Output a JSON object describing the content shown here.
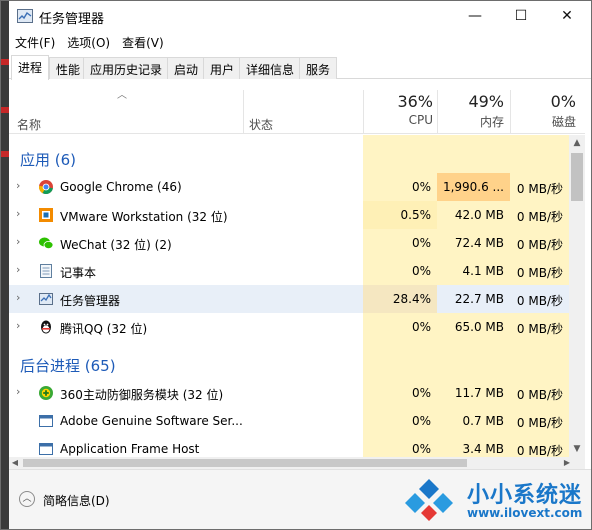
{
  "window": {
    "title": "任务管理器",
    "controls": {
      "minimize": "—",
      "maximize": "☐",
      "close": "✕"
    }
  },
  "menu": [
    "文件(F)",
    "选项(O)",
    "查看(V)"
  ],
  "tabs": [
    "进程",
    "性能",
    "应用历史记录",
    "启动",
    "用户",
    "详细信息",
    "服务"
  ],
  "active_tab": "进程",
  "columns": {
    "name": "名称",
    "status": "状态",
    "cpu": {
      "percent": "36%",
      "label": "CPU"
    },
    "memory": {
      "percent": "49%",
      "label": "内存"
    },
    "disk": {
      "percent": "0%",
      "label": "磁盘"
    }
  },
  "groups": [
    {
      "title": "应用 (6)",
      "rows": [
        {
          "name": "Google Chrome (46)",
          "icon": "chrome-icon",
          "cpu": "0%",
          "memory": "1,990.6 ...",
          "disk": "0 MB/秒"
        },
        {
          "name": "VMware Workstation (32 位)",
          "icon": "vmware-icon",
          "cpu": "0.5%",
          "memory": "42.0 MB",
          "disk": "0 MB/秒"
        },
        {
          "name": "WeChat (32 位) (2)",
          "icon": "wechat-icon",
          "cpu": "0%",
          "memory": "72.4 MB",
          "disk": "0 MB/秒"
        },
        {
          "name": "记事本",
          "icon": "notepad-icon",
          "cpu": "0%",
          "memory": "4.1 MB",
          "disk": "0 MB/秒"
        },
        {
          "name": "任务管理器",
          "icon": "task-manager-icon",
          "cpu": "28.4%",
          "memory": "22.7 MB",
          "disk": "0 MB/秒"
        },
        {
          "name": "腾讯QQ (32 位)",
          "icon": "qq-icon",
          "cpu": "0%",
          "memory": "65.0 MB",
          "disk": "0 MB/秒"
        }
      ]
    },
    {
      "title": "后台进程 (65)",
      "rows": [
        {
          "name": "360主动防御服务模块 (32 位)",
          "icon": "360-icon",
          "cpu": "0%",
          "memory": "11.7 MB",
          "disk": "0 MB/秒"
        },
        {
          "name": "Adobe Genuine Software Ser...",
          "icon": "app-window-icon",
          "cpu": "0%",
          "memory": "0.7 MB",
          "disk": "0 MB/秒"
        },
        {
          "name": "Application Frame Host",
          "icon": "app-window-icon",
          "cpu": "0%",
          "memory": "3.4 MB",
          "disk": "0 MB/秒"
        }
      ]
    }
  ],
  "footer": {
    "fewer_details": "简略信息(D)"
  },
  "watermark": {
    "brand": "小小系统迷",
    "url": "www.ilovext.com"
  },
  "colors": {
    "group_title": "#1e5bb8",
    "heat_low": "#fff4c4",
    "heat_high": "#ffd28a",
    "selected_row": "#e8eff8",
    "watermark": "#1a77c9"
  }
}
